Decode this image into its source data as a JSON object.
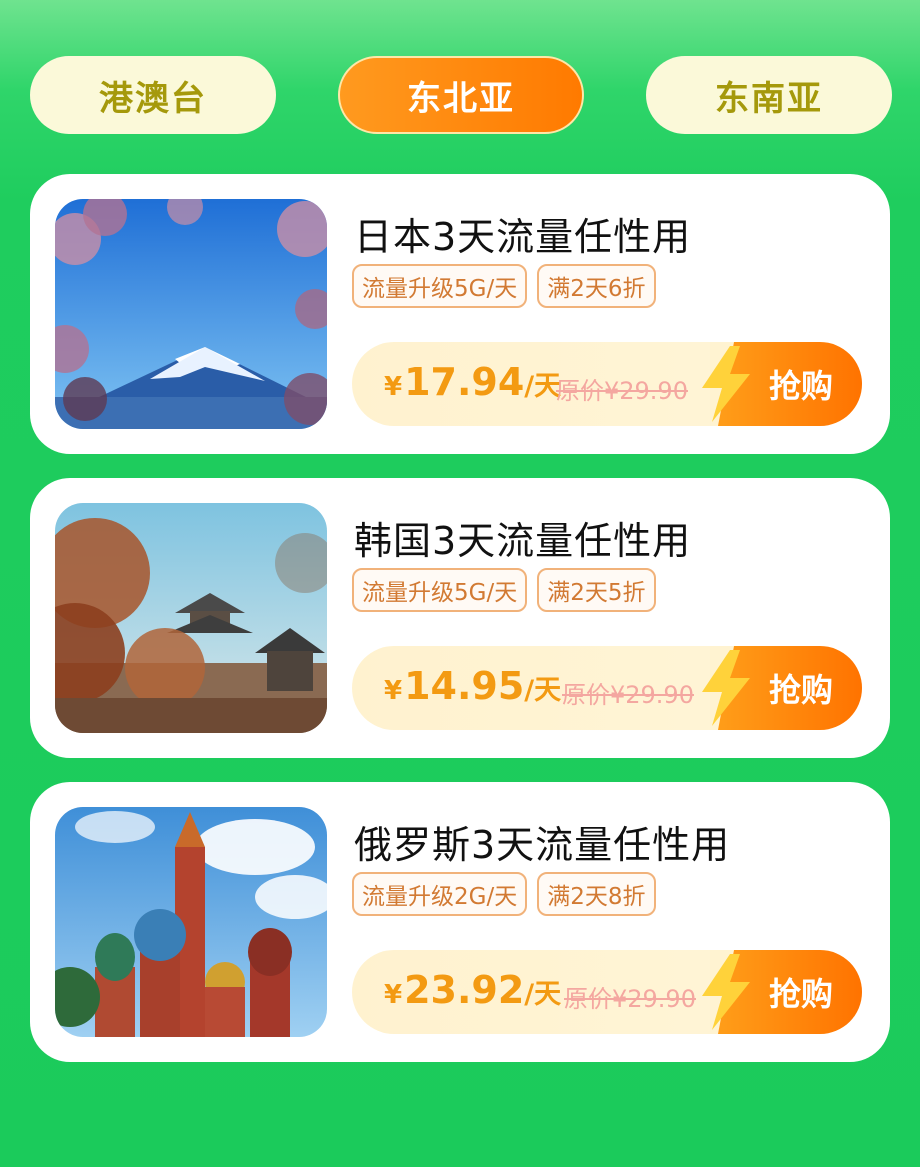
{
  "tabs": [
    {
      "label": "港澳台",
      "active": false
    },
    {
      "label": "东北亚",
      "active": true
    },
    {
      "label": "东南亚",
      "active": false
    }
  ],
  "colors": {
    "background": "#1fcd5e",
    "tab_bg": "#fbf9d9",
    "tab_text": "#a5990b",
    "tab_active": "#ff8a10",
    "price": "#f39a12",
    "buy_button": "#ff7a00"
  },
  "products": [
    {
      "title": "日本3天流量任性用",
      "image_icon": "mount-fuji-photo",
      "tags": [
        "流量升级5G/天",
        "满2天6折"
      ],
      "price_symbol": "¥",
      "price": "17.94",
      "price_unit": "/天",
      "original_price": "原价¥29.90",
      "buy_label": "抢购"
    },
    {
      "title": "韩国3天流量任性用",
      "image_icon": "korean-pagoda-photo",
      "tags": [
        "流量升级5G/天",
        "满2天5折"
      ],
      "price_symbol": "¥",
      "price": "14.95",
      "price_unit": "/天",
      "original_price": "原价¥29.90",
      "buy_label": "抢购"
    },
    {
      "title": "俄罗斯3天流量任性用",
      "image_icon": "st-basil-cathedral-photo",
      "tags": [
        "流量升级2G/天",
        "满2天8折"
      ],
      "price_symbol": "¥",
      "price": "23.92",
      "price_unit": "/天",
      "original_price": "原价¥29.90",
      "buy_label": "抢购"
    }
  ]
}
